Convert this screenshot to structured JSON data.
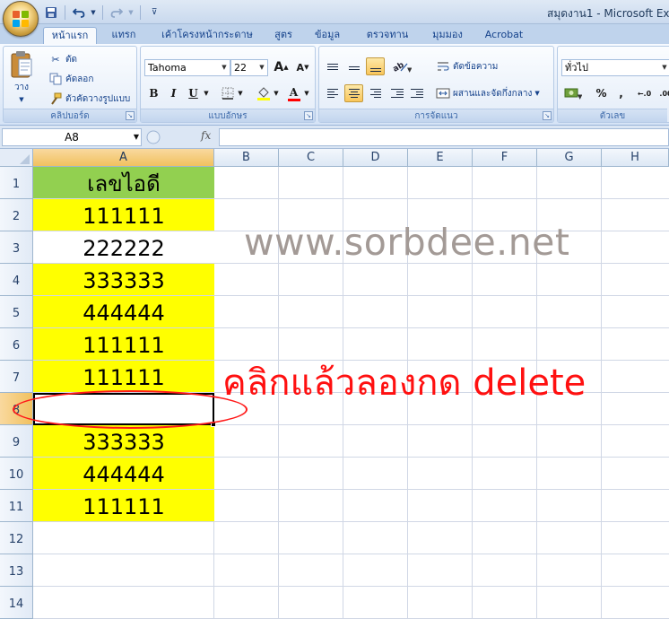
{
  "title": "สมุดงาน1 - Microsoft Exc",
  "quick_access": {
    "save_icon": "save-icon",
    "undo_icon": "undo-icon",
    "redo_icon": "redo-icon",
    "customize_icon": "customize-icon"
  },
  "tabs": [
    {
      "label": "หน้าแรก",
      "active": true
    },
    {
      "label": "แทรก"
    },
    {
      "label": "เค้าโครงหน้ากระดาษ"
    },
    {
      "label": "สูตร"
    },
    {
      "label": "ข้อมูล"
    },
    {
      "label": "ตรวจทาน"
    },
    {
      "label": "มุมมอง"
    },
    {
      "label": "Acrobat"
    }
  ],
  "ribbon": {
    "clipboard": {
      "label": "คลิปบอร์ด",
      "paste": "วาง",
      "cut": "ตัด",
      "copy": "คัดลอก",
      "format_painter": "ตัวคัดวางรูปแบบ"
    },
    "font": {
      "label": "แบบอักษร",
      "font_name": "Tahoma",
      "font_size": "22",
      "bold": "B",
      "italic": "I",
      "underline": "U",
      "font_color": "A"
    },
    "alignment": {
      "label": "การจัดแนว",
      "wrap_text": "ตัดข้อความ",
      "merge_center": "ผสานและจัดกึ่งกลาง"
    },
    "number": {
      "label": "ตัวเลข",
      "format": "ทั่วไป",
      "percent": "%",
      "comma": ","
    }
  },
  "formula_bar": {
    "name_box": "A8",
    "fx": "fx",
    "value": ""
  },
  "columns": [
    "A",
    "B",
    "C",
    "D",
    "E",
    "F",
    "G",
    "H"
  ],
  "rows": [
    "1",
    "2",
    "3",
    "4",
    "5",
    "6",
    "7",
    "8",
    "9",
    "10",
    "11",
    "12",
    "13",
    "14"
  ],
  "column_a": [
    {
      "row": 1,
      "value": "เลขไอดี",
      "fill": "#92d050"
    },
    {
      "row": 2,
      "value": "111111",
      "fill": "#ffff00"
    },
    {
      "row": 3,
      "value": "222222",
      "fill": "#ffffff"
    },
    {
      "row": 4,
      "value": "333333",
      "fill": "#ffff00"
    },
    {
      "row": 5,
      "value": "444444",
      "fill": "#ffff00"
    },
    {
      "row": 6,
      "value": "111111",
      "fill": "#ffff00"
    },
    {
      "row": 7,
      "value": "111111",
      "fill": "#ffff00"
    },
    {
      "row": 8,
      "value": "",
      "fill": "#ffffff"
    },
    {
      "row": 9,
      "value": "333333",
      "fill": "#ffff00"
    },
    {
      "row": 10,
      "value": "444444",
      "fill": "#ffff00"
    },
    {
      "row": 11,
      "value": "111111",
      "fill": "#ffff00"
    }
  ],
  "selected_cell": "A8",
  "watermark": "www.sorbdee.net",
  "instruction": "คลิกแล้วลองกด delete",
  "colors": {
    "accent": "#ff1a1a",
    "yellow": "#ffff00",
    "green": "#92d050"
  }
}
